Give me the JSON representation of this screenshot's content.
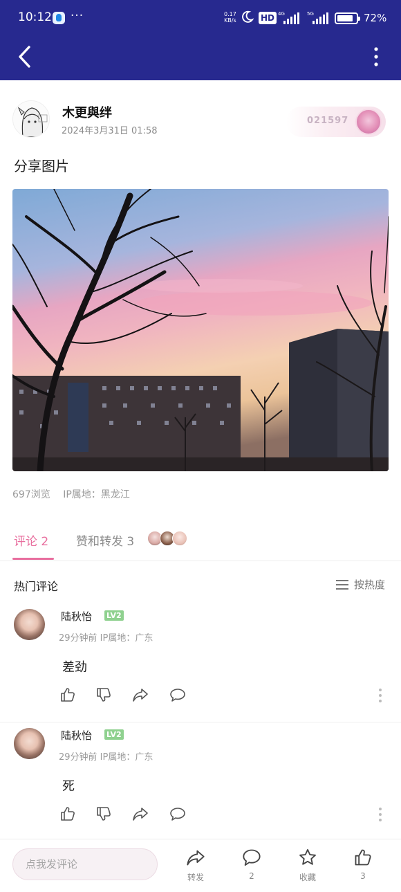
{
  "status_bar": {
    "time": "10:12",
    "dots": "···",
    "net_speed_value": "0.17",
    "net_speed_unit": "KB/s",
    "hd": "HD",
    "net1": "4G",
    "net2": "5G",
    "battery_percent": "72%"
  },
  "author": {
    "name": "木更與绊",
    "time": "2024年3月31日 01:58",
    "badge_number": "021597"
  },
  "post": {
    "text": "分享图片",
    "views": "697浏览",
    "ip": "IP属地：黑龙江"
  },
  "tabs": {
    "comments": "评论 2",
    "likes_reposts": "赞和转发 3"
  },
  "hot_comments": {
    "title": "热门评论",
    "sort_label": "按热度"
  },
  "comments": [
    {
      "name": "陆秋怡",
      "level": "LV2",
      "info": "29分钟前  IP属地：广东",
      "text": "差劲"
    },
    {
      "name": "陆秋怡",
      "level": "LV2",
      "info": "29分钟前  IP属地：广东",
      "text": "死"
    }
  ],
  "bottom_bar": {
    "input_placeholder": "点我发评论",
    "repost_label": "转发",
    "comment_count": "2",
    "favorite_label": "收藏",
    "like_count": "3"
  },
  "colors": {
    "app_bar": "#27298f",
    "accent_pink": "#e86e9e",
    "level_green": "#8fd18f"
  }
}
